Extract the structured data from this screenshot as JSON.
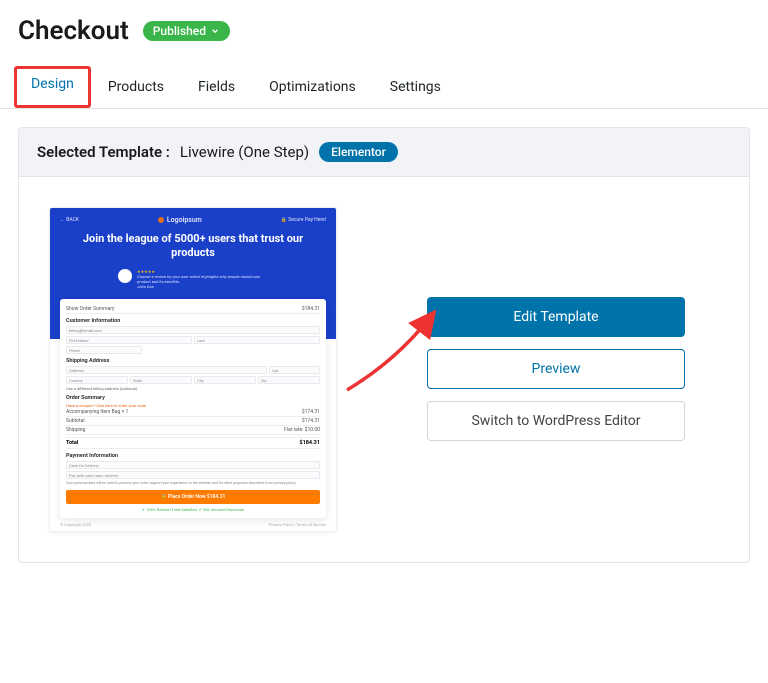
{
  "header": {
    "title": "Checkout",
    "status": "Published"
  },
  "tabs": [
    {
      "label": "Design",
      "active": true,
      "highlighted": true
    },
    {
      "label": "Products",
      "active": false,
      "highlighted": false
    },
    {
      "label": "Fields",
      "active": false,
      "highlighted": false
    },
    {
      "label": "Optimizations",
      "active": false,
      "highlighted": false
    },
    {
      "label": "Settings",
      "active": false,
      "highlighted": false
    }
  ],
  "panel": {
    "label": "Selected Template :",
    "template_name": "Livewire  (One Step)",
    "builder_pill": "Elementor"
  },
  "actions": {
    "edit": "Edit Template",
    "preview": "Preview",
    "switch": "Switch to WordPress Editor"
  },
  "preview": {
    "back": "← BACK",
    "logo": "Logoipsum",
    "secure": "🔒 Secure Pay Here!",
    "headline": "Join the league of 5000+ users that trust our products",
    "review_text": "Choose a review by your user which highlights why people should use product and its benefits.",
    "review_author": "John Doe",
    "summary_toggle": "Show Order Summary",
    "summary_price": "$184.31",
    "sec_customer": "Customer Information",
    "email_ph": "billing@email.com",
    "fname_ph": "First Name",
    "lname_ph": "Last",
    "phone_ph": "Phone",
    "sec_shipping": "Shipping Address",
    "addr_ph": "Address",
    "apt_ph": "Apt",
    "country_ph": "Country",
    "state_ph": "State",
    "city_ph": "City",
    "zip_ph": "Zip",
    "diff_addr": "Use a different billing address (optional)",
    "sec_order": "Order Summary",
    "coupon_link": "Have a coupon? Click here to enter your code",
    "item_name": "Accompanying Item Bag × 1",
    "item_price": "$174.31",
    "subtotal_label": "Subtotal",
    "subtotal_value": "$174.31",
    "shipping_label": "Shipping",
    "shipping_value": "Flat rate: $10.00",
    "total_label": "Total",
    "total_value": "$184.31",
    "sec_payment": "Payment Information",
    "pay_cod": "Cash On Delivery",
    "pay_desc": "Pay with cash upon delivery.",
    "terms_text": "Your personal data will be used to process your order, support your experience on the website, and for other purposes described in our privacy policy.",
    "order_btn": "🔒  Place Order Now  $184.31",
    "trust1": "✔ 100% Refund If Not Satisfied",
    "trust2": "✔ SSL Secured Payments",
    "footer_copyright": "© Copyright 2023",
    "footer_links": "Privacy Policy | Terms of Service"
  }
}
